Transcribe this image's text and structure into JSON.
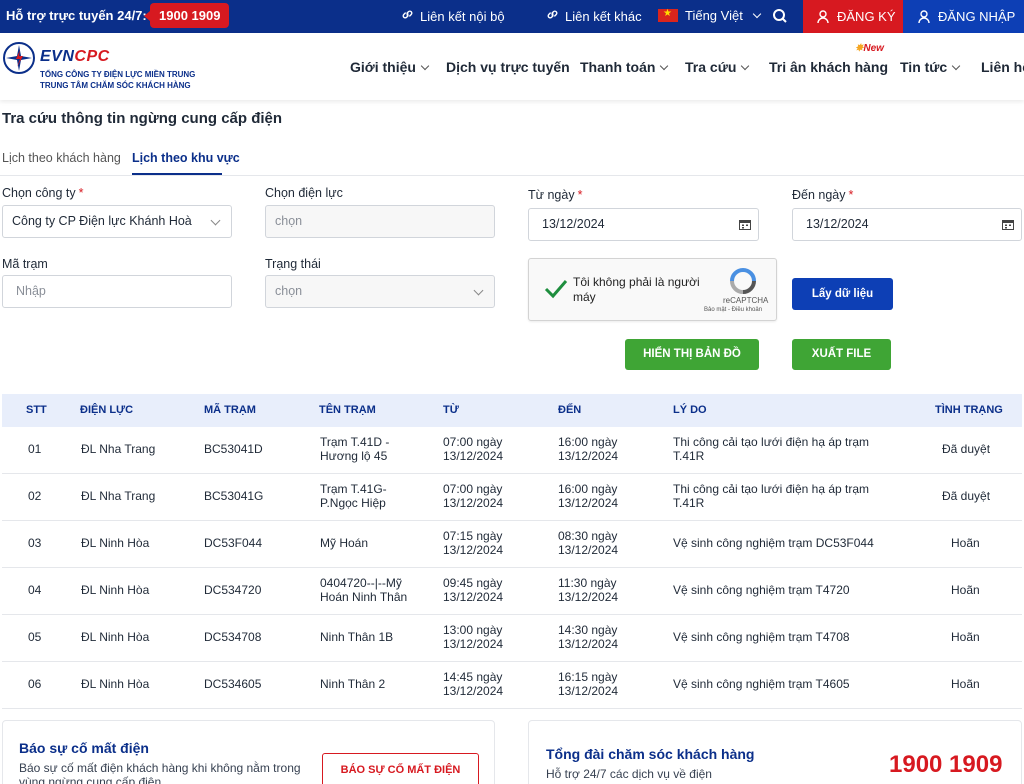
{
  "topbar": {
    "support_label": "Hỗ trợ trực tuyến 24/7:",
    "hotline": "1900 1909",
    "internal_link": "Liên kết nội bộ",
    "other_link": "Liên kết khác",
    "language": "Tiếng Việt",
    "register": "ĐĂNG KÝ",
    "login": "ĐĂNG NHẬP"
  },
  "header": {
    "brand_evn": "EVN",
    "brand_cpc": "CPC",
    "sub1": "TỔNG CÔNG TY ĐIỆN LỰC MIỀN TRUNG",
    "sub2": "TRUNG TÂM CHĂM SÓC KHÁCH HÀNG",
    "nav": [
      {
        "label": "Giới thiệu"
      },
      {
        "label": "Dịch vụ trực tuyến"
      },
      {
        "label": "Thanh toán"
      },
      {
        "label": "Tra cứu"
      },
      {
        "label": "Tri ân khách hàng"
      },
      {
        "label": "Tin tức"
      },
      {
        "label": "Liên hệ"
      }
    ],
    "new_badge": "New"
  },
  "page": {
    "title": "Tra cứu thông tin ngừng cung cấp điện",
    "tabs": [
      {
        "label": "Lịch theo khách hàng"
      },
      {
        "label": "Lịch theo khu vực"
      }
    ]
  },
  "form": {
    "company_label": "Chọn công ty",
    "company_value": "Công ty CP Điện lực Khánh Hoà",
    "power_label": "Chọn điện lực",
    "power_placeholder": "chọn",
    "from_label": "Từ ngày",
    "from_value": "13/12/2024",
    "to_label": "Đến ngày",
    "to_value": "13/12/2024",
    "station_label": "Mã trạm",
    "station_placeholder": "Nhập",
    "status_label": "Trạng thái",
    "status_placeholder": "chọn",
    "required_mark": "*",
    "captcha_text": "Tôi không phải là người máy",
    "captcha_brand": "reCAPTCHA",
    "captcha_terms": "Bảo mật - Điều khoản",
    "fetch_button": "Lấy dữ liệu",
    "map_button": "HIỂN THỊ BẢN ĐỒ",
    "export_button": "XUẤT FILE"
  },
  "table": {
    "headers": [
      "STT",
      "ĐIỆN LỰC",
      "MÃ TRẠM",
      "TÊN TRẠM",
      "TỪ",
      "ĐẾN",
      "LÝ DO",
      "TÌNH TRẠNG"
    ],
    "rows": [
      {
        "stt": "01",
        "unit": "ĐL Nha Trang",
        "code": "BC53041D",
        "name1": "Trạm T.41D -",
        "name2": "Hương lộ 45",
        "from1": "07:00 ngày",
        "from2": "13/12/2024",
        "to1": "16:00 ngày",
        "to2": "13/12/2024",
        "reason1": "Thi công cải tạo lưới điện hạ áp trạm",
        "reason2": "T.41R",
        "status": "Đã duyệt"
      },
      {
        "stt": "02",
        "unit": "ĐL Nha Trang",
        "code": "BC53041G",
        "name1": "Trạm T.41G-",
        "name2": "P.Ngọc Hiệp",
        "from1": "07:00 ngày",
        "from2": "13/12/2024",
        "to1": "16:00 ngày",
        "to2": "13/12/2024",
        "reason1": "Thi công cải tạo lưới điện hạ áp trạm",
        "reason2": "T.41R",
        "status": "Đã duyệt"
      },
      {
        "stt": "03",
        "unit": "ĐL Ninh Hòa",
        "code": "DC53F044",
        "name1": "Mỹ Hoán",
        "name2": "",
        "from1": "07:15 ngày",
        "from2": "13/12/2024",
        "to1": "08:30 ngày",
        "to2": "13/12/2024",
        "reason1": "Vệ sinh công nghiệm trạm DC53F044",
        "reason2": "",
        "status": "Hoãn"
      },
      {
        "stt": "04",
        "unit": "ĐL Ninh Hòa",
        "code": "DC534720",
        "name1": "0404720--|--Mỹ",
        "name2": "Hoán Ninh Thân",
        "from1": "09:45 ngày",
        "from2": "13/12/2024",
        "to1": "11:30 ngày",
        "to2": "13/12/2024",
        "reason1": "Vệ sinh công nghiệm trạm T4720",
        "reason2": "",
        "status": "Hoãn"
      },
      {
        "stt": "05",
        "unit": "ĐL Ninh Hòa",
        "code": "DC534708",
        "name1": "Ninh Thân 1B",
        "name2": "",
        "from1": "13:00 ngày",
        "from2": "13/12/2024",
        "to1": "14:30 ngày",
        "to2": "13/12/2024",
        "reason1": "Vệ sinh công nghiệm trạm T4708",
        "reason2": "",
        "status": "Hoãn"
      },
      {
        "stt": "06",
        "unit": "ĐL Ninh Hòa",
        "code": "DC534605",
        "name1": "Ninh Thân 2",
        "name2": "",
        "from1": "14:45 ngày",
        "from2": "13/12/2024",
        "to1": "16:15 ngày",
        "to2": "13/12/2024",
        "reason1": "Vệ sinh công nghiệm trạm T4605",
        "reason2": "",
        "status": "Hoãn"
      }
    ]
  },
  "footer": {
    "report_title": "Báo sự cố mất điện",
    "report_desc1": "Báo sự cố mất điện khách hàng khi không nằm trong",
    "report_desc2": "vùng ngừng cung cấp điện",
    "report_button": "BÁO SỰ CỐ MẤT ĐIỆN",
    "care_title": "Tổng đài chăm sóc khách hàng",
    "care_desc": "Hỗ trợ 24/7 các dịch vụ về điện",
    "care_hotline": "1900 1909"
  },
  "colors": {
    "primary": "#0b2f8a",
    "accent_red": "#d71920",
    "green": "#3fa535"
  }
}
